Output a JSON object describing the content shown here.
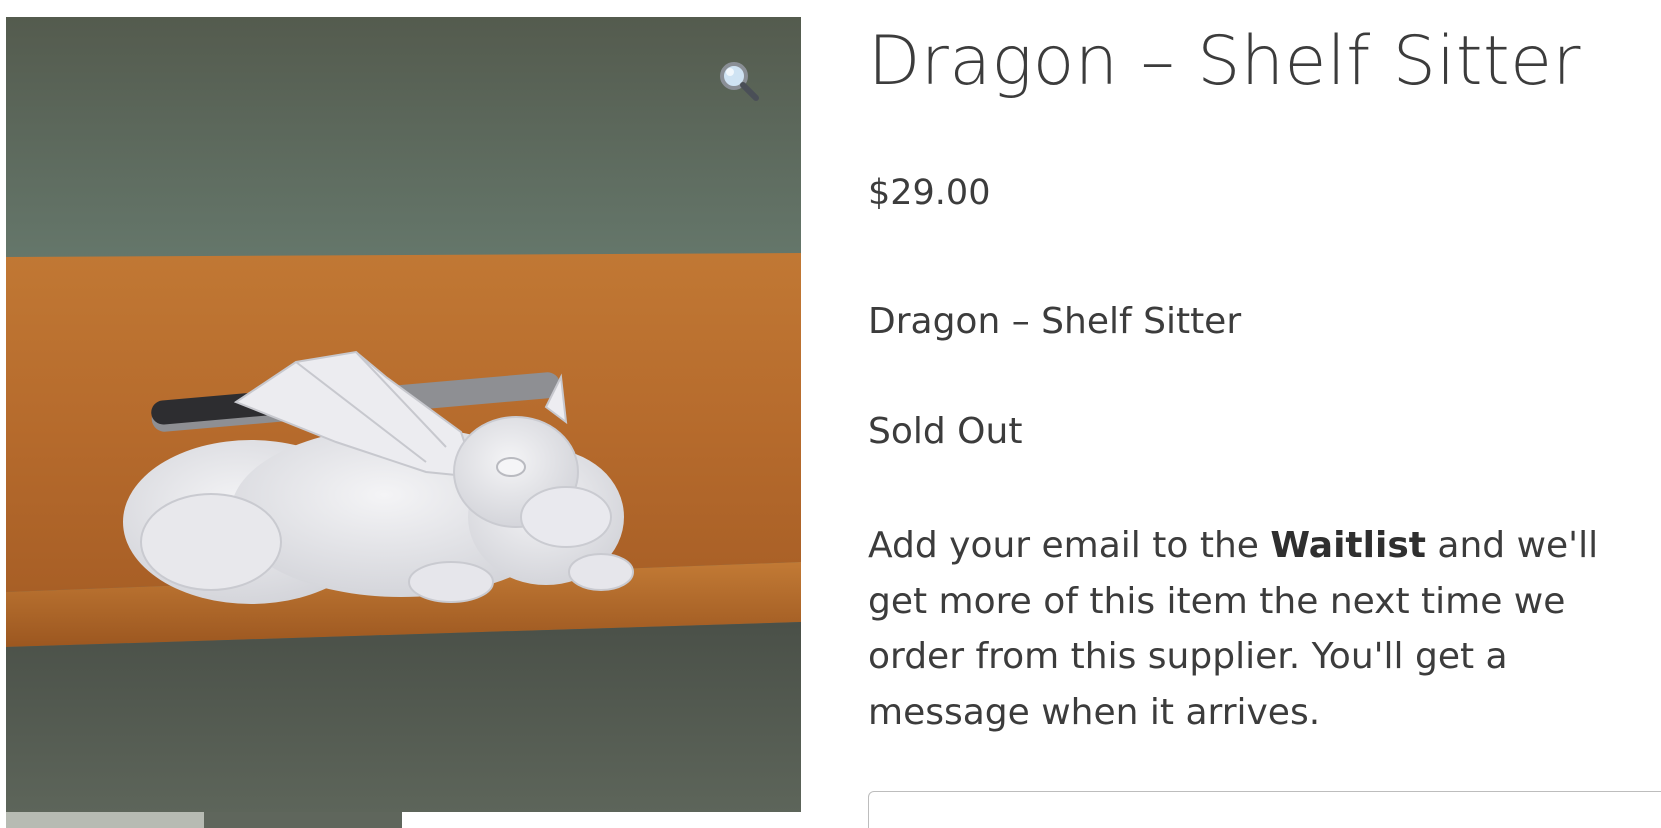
{
  "product": {
    "title": "Dragon – Shelf Sitter",
    "price": "$29.00",
    "short_description": "Dragon – Shelf Sitter",
    "stock_status": "Sold Out"
  },
  "waitlist": {
    "text_before": "Add your email to the ",
    "emphasis": "Waitlist",
    "text_after": " and we'll get more of this item the next time we order from this supplier. You'll get a message when it arrives.",
    "email_value": ""
  },
  "gallery": {
    "zoom_icon": "magnifying-glass-icon",
    "thumbnail_count": 2
  },
  "colors": {
    "text": "#3c3c3c",
    "wall": "#5d6a60",
    "shelf": "#b8702f"
  }
}
